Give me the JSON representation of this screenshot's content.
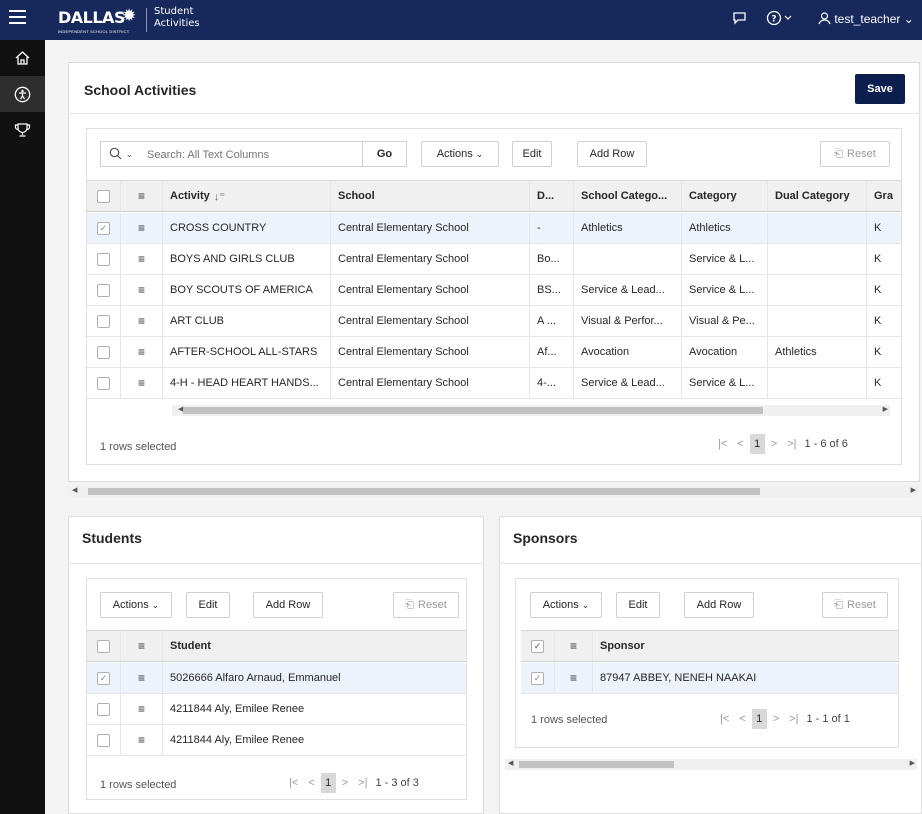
{
  "header": {
    "logo": "DALLAS",
    "logo_sub": "INDEPENDENT SCHOOL DISTRICT",
    "app_title_1": "Student",
    "app_title_2": "Activities",
    "user": "test_teacher"
  },
  "activities": {
    "title": "School Activities",
    "save_label": "Save",
    "search_placeholder": "Search: All Text Columns",
    "go_label": "Go",
    "actions_label": "Actions",
    "edit_label": "Edit",
    "add_row_label": "Add Row",
    "reset_label": "Reset",
    "columns": [
      "Activity",
      "School",
      "D...",
      "School Catego...",
      "Category",
      "Dual Category",
      "Gra"
    ],
    "rows": [
      {
        "activity": "CROSS COUNTRY",
        "school": "Central Elementary School",
        "d": "-",
        "school_cat": "Athletics",
        "category": "Athletics",
        "dual": "",
        "grade": "K",
        "selected": true
      },
      {
        "activity": "BOYS AND GIRLS CLUB",
        "school": "Central Elementary School",
        "d": "Bo...",
        "school_cat": "",
        "category": "Service & L...",
        "dual": "",
        "grade": "K",
        "selected": false
      },
      {
        "activity": "BOY SCOUTS OF AMERICA",
        "school": "Central Elementary School",
        "d": "BS...",
        "school_cat": "Service & Lead...",
        "category": "Service & L...",
        "dual": "",
        "grade": "K",
        "selected": false
      },
      {
        "activity": "ART CLUB",
        "school": "Central Elementary School",
        "d": "A ...",
        "school_cat": "Visual & Perfor...",
        "category": "Visual & Pe...",
        "dual": "",
        "grade": "K",
        "selected": false
      },
      {
        "activity": "AFTER-SCHOOL ALL-STARS",
        "school": "Central Elementary School",
        "d": "Af...",
        "school_cat": "Avocation",
        "category": "Avocation",
        "dual": "Athletics",
        "grade": "K",
        "selected": false
      },
      {
        "activity": "4-H - HEAD HEART HANDS...",
        "school": "Central Elementary School",
        "d": "4-...",
        "school_cat": "Service & Lead...",
        "category": "Service & L...",
        "dual": "",
        "grade": "K",
        "selected": false
      }
    ],
    "selected_text": "1 rows selected",
    "page": "1",
    "range": "1 - 6 of 6"
  },
  "students": {
    "title": "Students",
    "actions_label": "Actions",
    "edit_label": "Edit",
    "add_row_label": "Add Row",
    "reset_label": "Reset",
    "column": "Student",
    "rows": [
      {
        "name": "5026666 Alfaro Arnaud, Emmanuel",
        "selected": true
      },
      {
        "name": "4211844 Aly, Emilee Renee",
        "selected": false
      },
      {
        "name": "4211844 Aly, Emilee Renee",
        "selected": false
      }
    ],
    "selected_text": "1 rows selected",
    "page": "1",
    "range": "1 - 3 of 3"
  },
  "sponsors": {
    "title": "Sponsors",
    "actions_label": "Actions",
    "edit_label": "Edit",
    "add_row_label": "Add Row",
    "reset_label": "Reset",
    "column": "Sponsor",
    "rows": [
      {
        "name": "87947 ABBEY, NENEH NAAKAI",
        "selected": true
      }
    ],
    "selected_text": "1 rows selected",
    "page": "1",
    "range": "1 - 1 of 1"
  }
}
